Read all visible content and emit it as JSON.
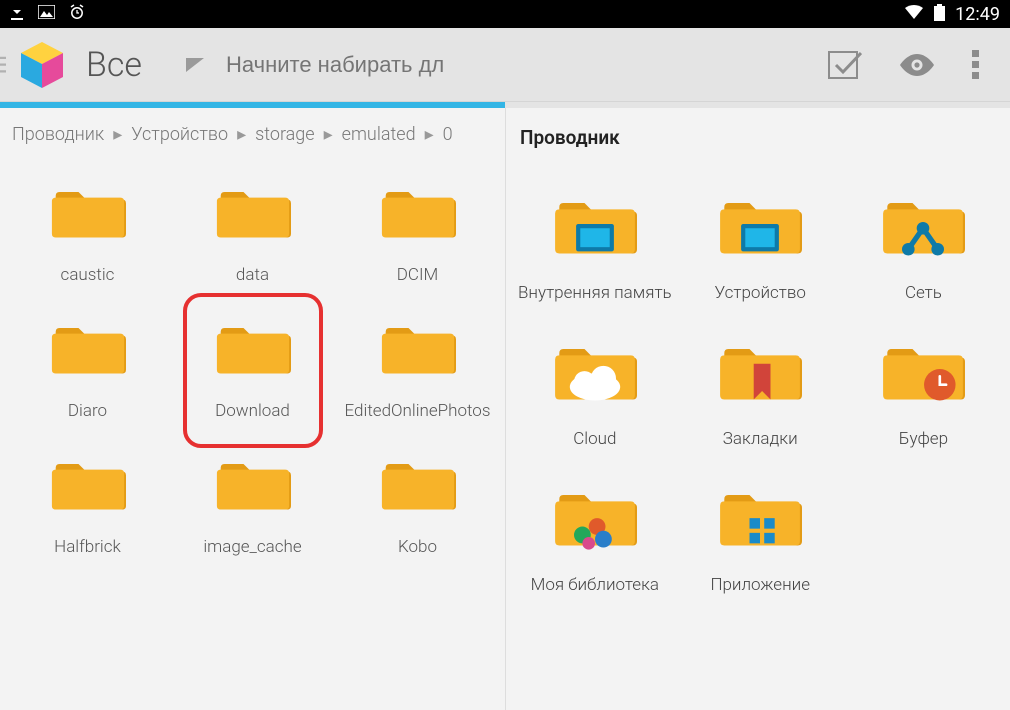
{
  "status_bar": {
    "clock": "12:49"
  },
  "toolbar": {
    "title": "Все",
    "search_placeholder": "Начните набирать дл"
  },
  "left_panel": {
    "breadcrumbs": [
      "Проводник",
      "Устройство",
      "storage",
      "emulated",
      "0"
    ],
    "folders": [
      {
        "label": "caustic"
      },
      {
        "label": "data"
      },
      {
        "label": "DCIM"
      },
      {
        "label": "Diaro"
      },
      {
        "label": "Download",
        "highlight": true
      },
      {
        "label": "EditedOnlinePhotos"
      },
      {
        "label": "Halfbrick"
      },
      {
        "label": "image_cache"
      },
      {
        "label": "Kobo"
      }
    ]
  },
  "right_panel": {
    "title": "Проводник",
    "items": [
      {
        "label": "Внутренняя память",
        "variant": "internal"
      },
      {
        "label": "Устройство",
        "variant": "device"
      },
      {
        "label": "Сеть",
        "variant": "network"
      },
      {
        "label": "Cloud",
        "variant": "cloud"
      },
      {
        "label": "Закладки",
        "variant": "bookmark"
      },
      {
        "label": "Буфер",
        "variant": "clock"
      },
      {
        "label": "Моя библиотека",
        "variant": "library"
      },
      {
        "label": "Приложение",
        "variant": "apps"
      }
    ]
  }
}
